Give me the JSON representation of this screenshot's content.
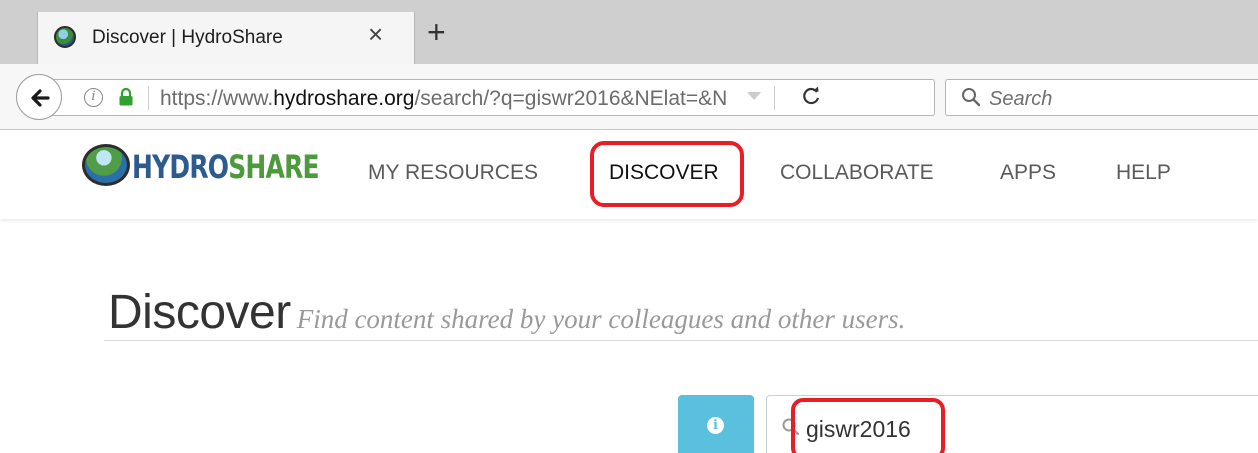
{
  "browser": {
    "tab": {
      "title": "Discover | HydroShare",
      "close_glyph": "×"
    },
    "new_tab_glyph": "+",
    "url": {
      "prefix": "https://www.",
      "host": "hydroshare.org",
      "path": "/search/?q=giswr2016&NElat=&N"
    },
    "search_placeholder": "Search",
    "icons": [
      "site-favicon",
      "back-arrow-icon",
      "info-icon",
      "lock-icon",
      "dropdown-arrow-icon",
      "reload-icon",
      "search-icon"
    ]
  },
  "site": {
    "logo": {
      "part1": "HYDRO",
      "part2": "SHARE"
    },
    "nav": [
      {
        "label": "MY RESOURCES"
      },
      {
        "label": "DISCOVER",
        "active": true
      },
      {
        "label": "COLLABORATE"
      },
      {
        "label": "APPS"
      },
      {
        "label": "HELP"
      }
    ]
  },
  "page": {
    "title": "Discover",
    "subtitle": "Find content shared by your colleagues and other users.",
    "search": {
      "info_glyph": "i",
      "query": "giswr2016"
    }
  },
  "colors": {
    "accent_info": "#5bc0de",
    "highlight": "#e81e26",
    "logo_blue": "#2d5a8f",
    "logo_green": "#4d9a3c"
  }
}
